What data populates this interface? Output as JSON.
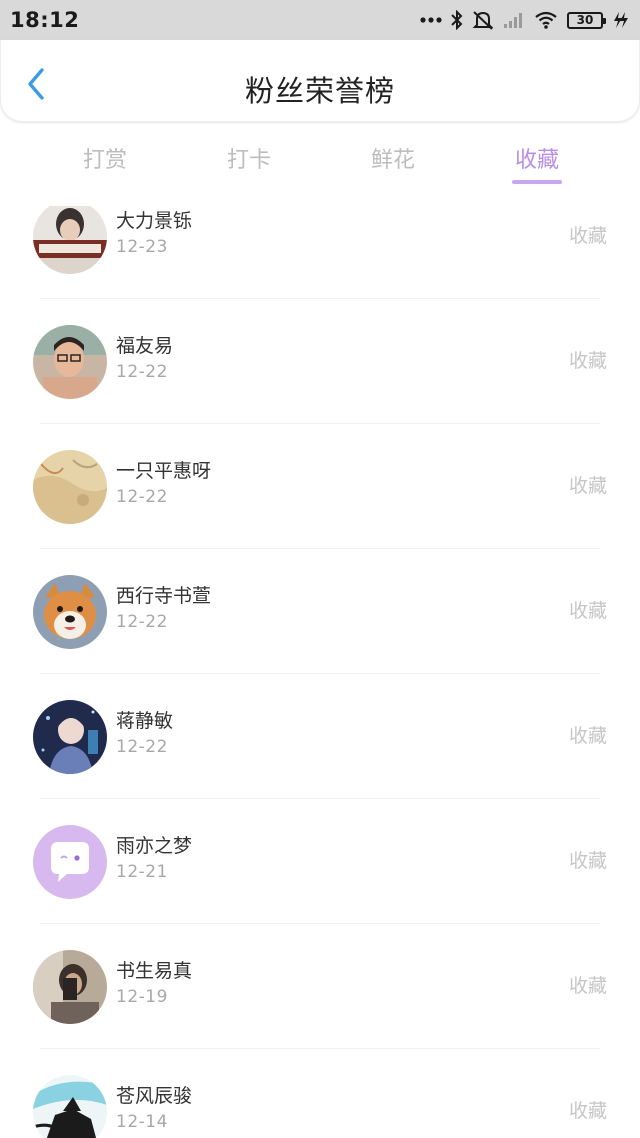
{
  "status_bar": {
    "time": "18:12",
    "battery": "30",
    "icons": [
      "more-dots-icon",
      "bluetooth-icon",
      "mute-icon",
      "signal-icon",
      "wifi-icon",
      "battery-icon",
      "charging-icon"
    ]
  },
  "header": {
    "title": "粉丝荣誉榜",
    "back_icon": "chevron-left-icon",
    "accent": "#3a9be8"
  },
  "tabs": [
    {
      "label": "打赏",
      "active": false
    },
    {
      "label": "打卡",
      "active": false
    },
    {
      "label": "鲜花",
      "active": false
    },
    {
      "label": "收藏",
      "active": true
    }
  ],
  "colors": {
    "active_tab": "#b98ee5",
    "inactive_tab": "#bdbdbd",
    "action_text": "#c6c6c6"
  },
  "items": [
    {
      "name": "大力景铄",
      "date": "12-23",
      "action": "收藏"
    },
    {
      "name": "福友易",
      "date": "12-22",
      "action": "收藏"
    },
    {
      "name": "一只平惠呀",
      "date": "12-22",
      "action": "收藏"
    },
    {
      "name": "西行寺书萱",
      "date": "12-22",
      "action": "收藏"
    },
    {
      "name": "蒋静敏",
      "date": "12-22",
      "action": "收藏"
    },
    {
      "name": "雨亦之梦",
      "date": "12-21",
      "action": "收藏"
    },
    {
      "name": "书生易真",
      "date": "12-19",
      "action": "收藏"
    },
    {
      "name": "苍风辰骏",
      "date": "12-14",
      "action": "收藏"
    }
  ]
}
